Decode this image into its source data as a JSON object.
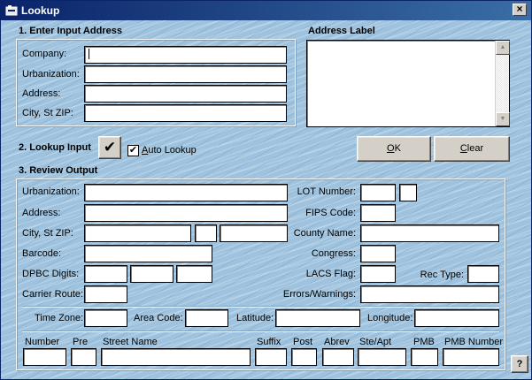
{
  "window": {
    "title": "Lookup",
    "close": "×"
  },
  "input_section": {
    "heading": "1. Enter Input Address",
    "company_label": "Company:",
    "company_value": "",
    "urbanization_label": "Urbanization:",
    "urbanization_value": "",
    "address_label": "Address:",
    "address_value": "",
    "citystzip_label": "City, St ZIP:",
    "citystzip_value": ""
  },
  "address_label_section": {
    "heading": "Address Label",
    "value": ""
  },
  "lookup_section": {
    "heading": "2. Lookup Input",
    "lookup_button": "✔",
    "auto_lookup_check": "✔",
    "auto_lookup_label_u": "A",
    "auto_lookup_label_rest": "uto Lookup",
    "auto_lookup_checked": true
  },
  "buttons": {
    "ok_u": "O",
    "ok_rest": "K",
    "clear_u": "C",
    "clear_rest": "lear",
    "help": "?"
  },
  "output_section": {
    "heading": "3. Review Output",
    "urbanization_label": "Urbanization:",
    "address_label": "Address:",
    "citystzip_label": "City, St ZIP:",
    "barcode_label": "Barcode:",
    "dpbc_label": "DPBC Digits:",
    "carrier_route_label": "Carrier Route:",
    "lot_number_label": "LOT Number:",
    "fips_code_label": "FIPS Code:",
    "county_name_label": "County Name:",
    "congress_label": "Congress:",
    "lacs_flag_label": "LACS Flag:",
    "rec_type_label": "Rec Type:",
    "errors_warnings_label": "Errors/Warnings:",
    "time_zone_label": "Time Zone:",
    "area_code_label": "Area Code:",
    "latitude_label": "Latitude:",
    "longitude_label": "Longitude:",
    "parsed_headers": {
      "number": "Number",
      "pre": "Pre",
      "street_name": "Street Name",
      "suffix": "Suffix",
      "post": "Post",
      "abrev": "Abrev",
      "ste_apt": "Ste/Apt",
      "pmb": "PMB",
      "pmb_number": "PMB Number"
    }
  },
  "colors": {
    "title_start": "#0a246a",
    "title_end": "#3a6ea5",
    "background": "#9fc3de",
    "button_face": "#d4d0c8"
  }
}
